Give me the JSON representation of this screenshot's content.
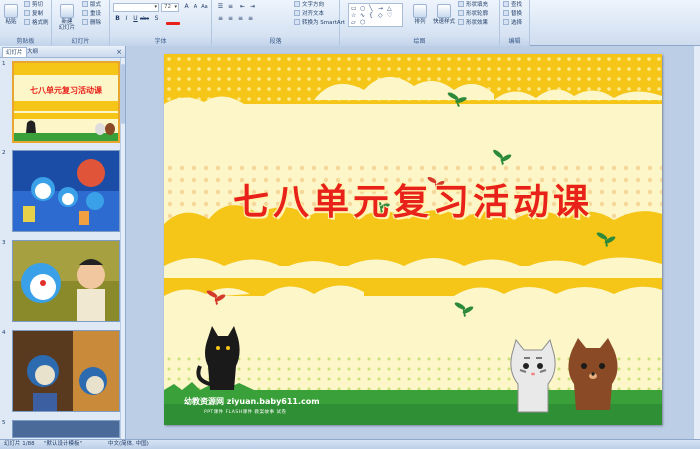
{
  "ribbon": {
    "clipboard": {
      "group_label": "剪贴板",
      "paste_label": "粘贴",
      "cut_label": "剪切",
      "copy_label": "复制",
      "format_painter_label": "格式刷"
    },
    "slides": {
      "group_label": "幻灯片",
      "new_slide_label": "新建\n幻灯片",
      "layout_label": "版式",
      "reset_label": "重设",
      "delete_label": "删除"
    },
    "font": {
      "group_label": "字体",
      "font_name": "",
      "font_size": "72",
      "grow": "A",
      "shrink": "A",
      "clear": "Aa",
      "bold": "B",
      "italic": "I",
      "underline": "U",
      "strike": "abc",
      "shadow": "S"
    },
    "paragraph": {
      "group_label": "段落",
      "text_direction": "文字方向",
      "align_text": "对齐文本",
      "smartart": "转换为 SmartArt"
    },
    "drawing": {
      "group_label": "绘图",
      "arrange_label": "排列",
      "quick_styles_label": "快速样式",
      "shape_fill": "形状填充",
      "shape_outline": "形状轮廓",
      "shape_effects": "形状效果"
    },
    "editing": {
      "group_label": "编辑",
      "find": "查找",
      "replace": "替换",
      "select": "选择"
    }
  },
  "pane": {
    "tab_slides": "幻灯片",
    "tab_outline": "大纲",
    "close": "×",
    "thumbnails": [
      {
        "num": "1"
      },
      {
        "num": "2"
      },
      {
        "num": "3"
      },
      {
        "num": "4"
      },
      {
        "num": "5"
      }
    ]
  },
  "slide": {
    "title": "七八单元复习活动课",
    "footer_brand": "幼教资源网 ziyuan.baby611.com",
    "footer_links": "PPT课件 FLASH课件 教案故事 试卷"
  },
  "status": {
    "slide_count": "幻灯片 1/88",
    "theme": "\"默认设计模板\"",
    "language": "中文(简体, 中国)"
  },
  "colors": {
    "title_red": "#e8211a",
    "yellow_band": "#f5c518",
    "cream": "#fdf6c8",
    "grass": "#3aa13a",
    "selection_orange": "#e8a530"
  }
}
